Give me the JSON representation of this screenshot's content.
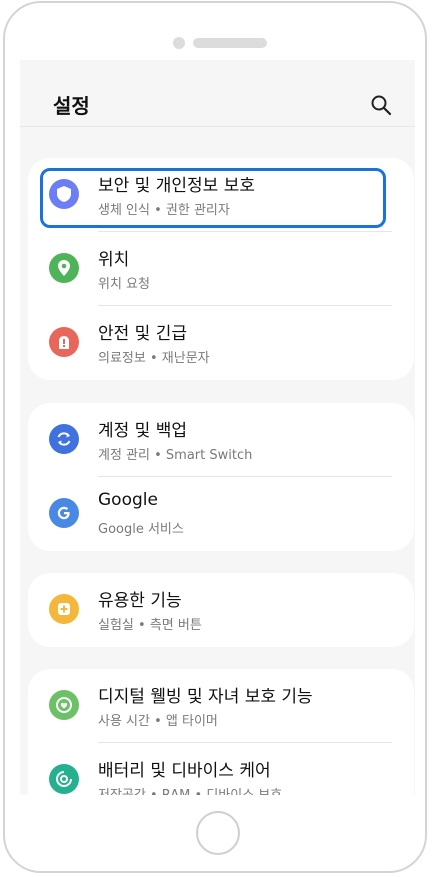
{
  "header": {
    "title": "설정"
  },
  "groups": [
    {
      "items": [
        {
          "label": "보안 및 개인정보 보호",
          "sub": "생체 인식  •  권한 관리자",
          "color": "#6c7ef5"
        },
        {
          "label": "위치",
          "sub": "위치 요청",
          "color": "#4fb35a"
        },
        {
          "label": "안전 및 긴급",
          "sub": "의료정보  •  재난문자",
          "color": "#e8665a"
        }
      ]
    },
    {
      "items": [
        {
          "label": "계정 및 백업",
          "sub": "계정 관리  •  Smart Switch",
          "color": "#3f72de"
        },
        {
          "label": "Google",
          "sub": "Google 서비스",
          "color": "#4a88e6"
        }
      ]
    },
    {
      "items": [
        {
          "label": "유용한 기능",
          "sub": "실험실  •  측면 버튼",
          "color": "#f4b73c"
        }
      ]
    },
    {
      "items": [
        {
          "label": "디지털 웰빙 및 자녀 보호 기능",
          "sub": "사용 시간  •  앱 타이머",
          "color": "#6cc068"
        },
        {
          "label": "배터리 및 디바이스 케어",
          "sub": "저장공간  •  RAM  •  디바이스 보호",
          "color": "#25b08f"
        }
      ]
    }
  ]
}
